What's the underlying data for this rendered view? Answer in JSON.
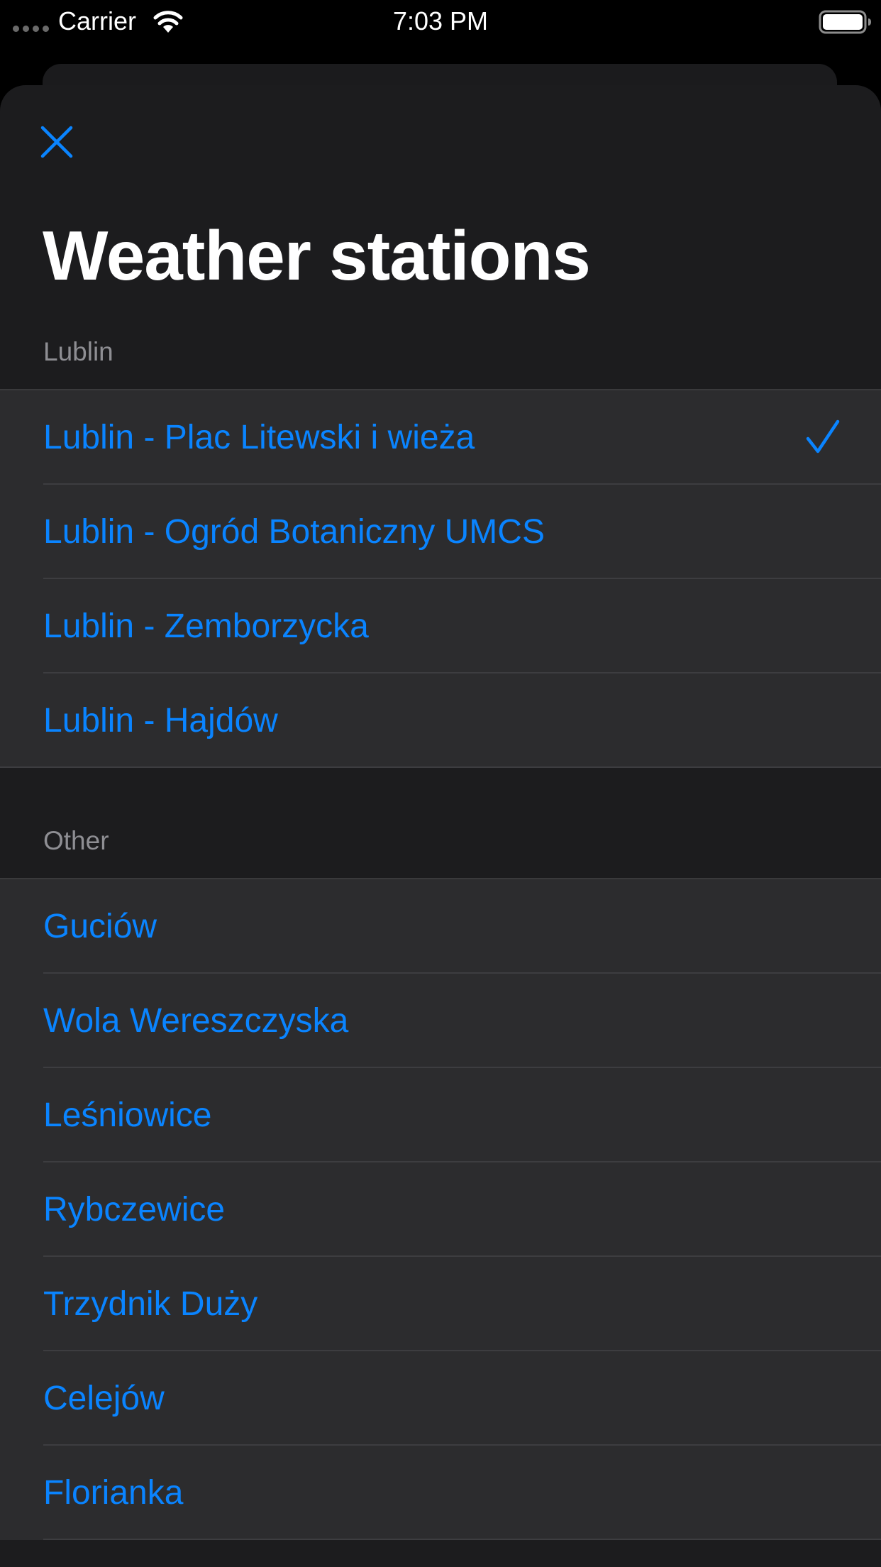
{
  "status_bar": {
    "carrier": "Carrier",
    "time": "7:03 PM",
    "icons": [
      "signal-dots-icon",
      "wifi-icon",
      "battery-icon"
    ]
  },
  "sheet": {
    "close_icon": "close-icon",
    "title": "Weather stations"
  },
  "sections": [
    {
      "header": "Lublin",
      "items": [
        {
          "label": "Lublin - Plac Litewski i wieża",
          "selected": true
        },
        {
          "label": "Lublin - Ogród Botaniczny UMCS",
          "selected": false
        },
        {
          "label": "Lublin - Zemborzycka",
          "selected": false
        },
        {
          "label": "Lublin - Hajdów",
          "selected": false
        }
      ]
    },
    {
      "header": "Other",
      "items": [
        {
          "label": "Guciów",
          "selected": false
        },
        {
          "label": "Wola Wereszczyska",
          "selected": false
        },
        {
          "label": "Leśniowice",
          "selected": false
        },
        {
          "label": "Rybczewice",
          "selected": false
        },
        {
          "label": "Trzydnik Duży",
          "selected": false
        },
        {
          "label": "Celejów",
          "selected": false
        },
        {
          "label": "Florianka",
          "selected": false
        }
      ]
    }
  ],
  "colors": {
    "accent": "#0a84ff",
    "background": "#000000",
    "sheet": "#1c1c1e",
    "row": "#2c2c2e",
    "secondary_text": "#8e8e93"
  }
}
